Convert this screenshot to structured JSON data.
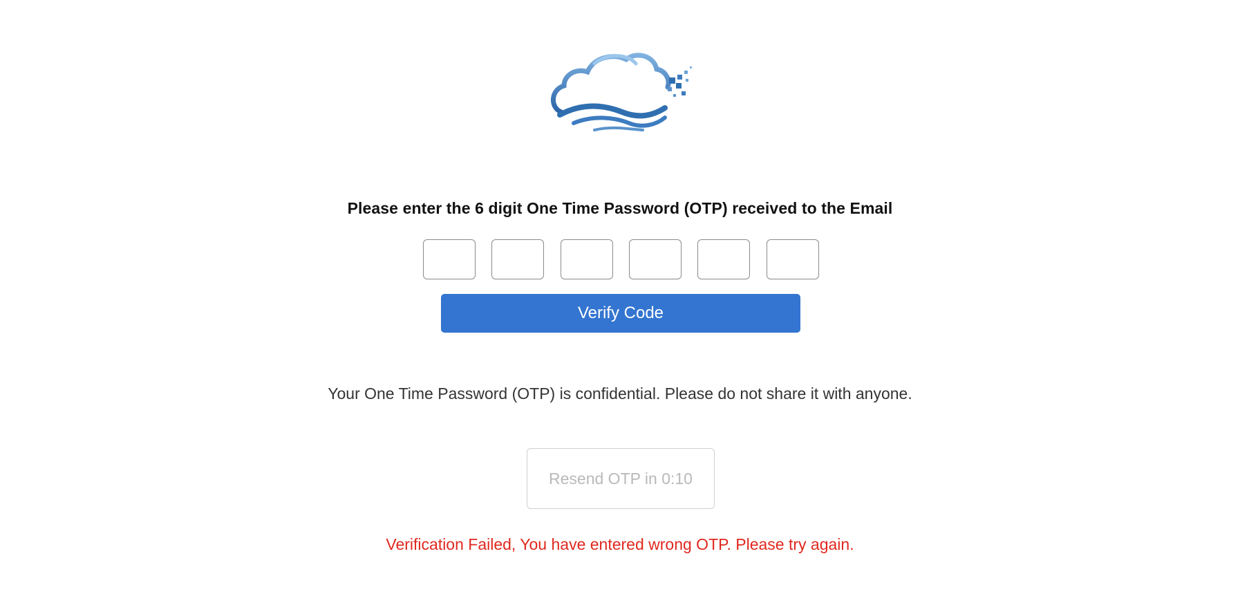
{
  "instruction": "Please enter the 6 digit One Time Password (OTP) received to the Email",
  "otp": {
    "digits": [
      "",
      "",
      "",
      "",
      "",
      ""
    ]
  },
  "verify_button": {
    "label": "Verify Code",
    "color": "#3375d0"
  },
  "notice": "Your One Time Password (OTP) is confidential. Please do not share it with anyone.",
  "resend_button": {
    "label": "Resend OTP in 0:10",
    "disabled": true
  },
  "error_message": "Verification Failed, You have entered wrong OTP. Please try again.",
  "colors": {
    "error": "#e0281f",
    "logo_primary": "#2f6fb0",
    "logo_light": "#6aa4d8"
  },
  "logo": {
    "icon": "cloud-logo-icon"
  }
}
